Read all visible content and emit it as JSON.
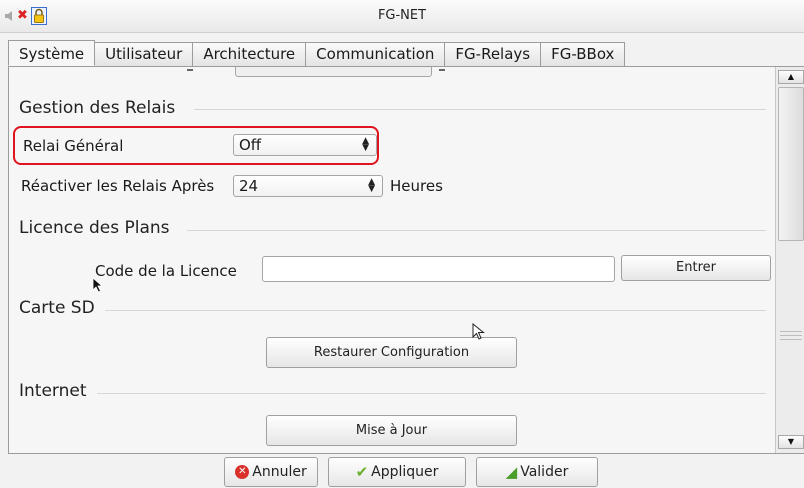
{
  "window": {
    "title": "FG-NET"
  },
  "tabs": [
    "Système",
    "Utilisateur",
    "Architecture",
    "Communication",
    "FG-Relays",
    "FG-BBox"
  ],
  "relais": {
    "section": "Gestion des Relais",
    "general_label": "Relai Général",
    "general_value": "Off",
    "reactivate_label": "Réactiver les Relais Après",
    "reactivate_value": "24",
    "reactivate_unit": "Heures"
  },
  "licence": {
    "section": "Licence des Plans",
    "code_label": "Code de la Licence",
    "code_value": "",
    "enter_button": "Entrer"
  },
  "sd": {
    "section": "Carte SD",
    "restore_button": "Restaurer Configuration"
  },
  "internet": {
    "section": "Internet",
    "update_button": "Mise à Jour"
  },
  "footer": {
    "cancel": "Annuler",
    "apply": "Appliquer",
    "validate": "Valider"
  },
  "colors": {
    "highlight": "#e0141e"
  },
  "icons": {
    "window": [
      "speaker-muted-icon",
      "close-x-icon",
      "lock-icon"
    ],
    "cancel": "cancel-icon",
    "apply": "checkmark-icon",
    "validate": "thumbs-up-icon"
  }
}
